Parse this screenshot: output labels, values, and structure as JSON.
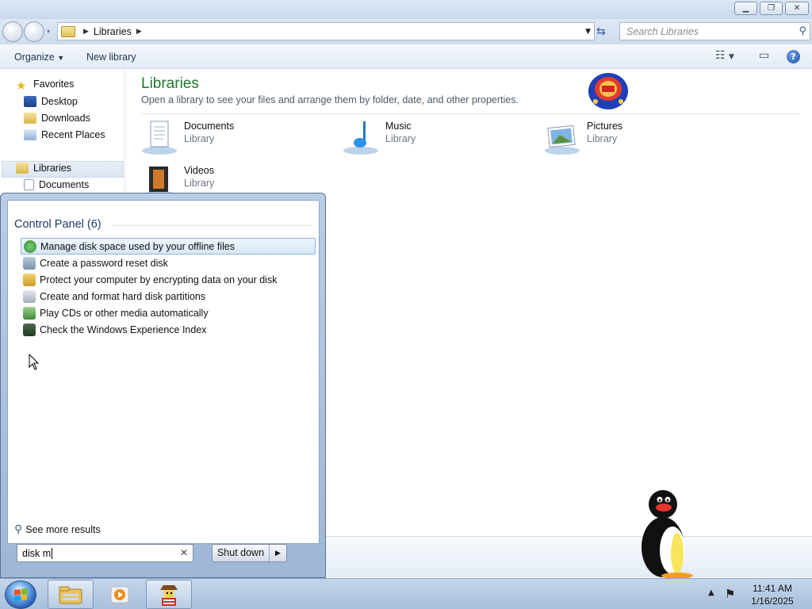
{
  "explorer": {
    "address": {
      "crumb": "Libraries"
    },
    "search_placeholder": "Search Libraries",
    "toolbar": {
      "organize": "Organize",
      "new_library": "New library"
    },
    "nav": {
      "favorites": "Favorites",
      "desktop": "Desktop",
      "downloads": "Downloads",
      "recent_places": "Recent Places",
      "libraries": "Libraries",
      "documents": "Documents"
    },
    "content": {
      "title": "Libraries",
      "subtitle": "Open a library to see your files and arrange them by folder, date, and other properties.",
      "items": [
        {
          "name": "Documents",
          "type": "Library"
        },
        {
          "name": "Music",
          "type": "Library"
        },
        {
          "name": "Pictures",
          "type": "Library"
        },
        {
          "name": "Videos",
          "type": "Library"
        }
      ]
    }
  },
  "start_menu": {
    "group_title": "Control Panel (6)",
    "results": [
      "Manage disk space used by your offline files",
      "Create a password reset disk",
      "Protect your computer by encrypting data on your disk",
      "Create and format hard disk partitions",
      "Play CDs or other media automatically",
      "Check the Windows Experience Index"
    ],
    "see_more": "See more results",
    "search_value": "disk m",
    "shutdown": "Shut down"
  },
  "taskbar": {
    "time": "11:41 AM",
    "date": "1/16/2025"
  },
  "colors": {
    "library_title": "#1c7a2c",
    "selection": "#d7e7f9"
  }
}
